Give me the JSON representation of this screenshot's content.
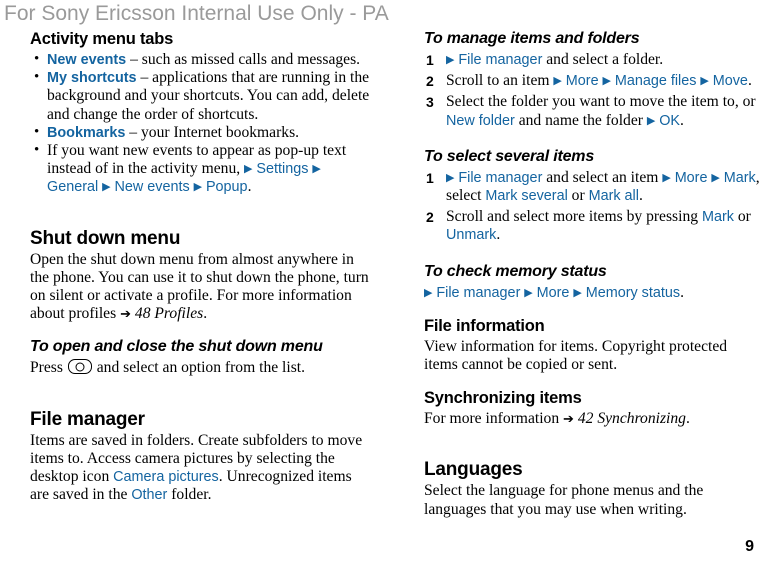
{
  "header": {
    "watermark": "For Sony Ericsson Internal Use Only - PA"
  },
  "page_number": "9",
  "left_column": {
    "activity_tabs": {
      "heading": "Activity menu tabs",
      "bullets": [
        {
          "term": "New events",
          "rest": " – such as missed calls and messages."
        },
        {
          "term": "My shortcuts",
          "rest": " – applications that are running in the background and your shortcuts. You can add, delete and change the order of shortcuts."
        },
        {
          "term": "Bookmarks",
          "rest": " – your Internet bookmarks."
        },
        {
          "plain_pre": "If you want new events to appear as pop-up text instead of in the activity menu, ",
          "path": [
            "Settings",
            "General",
            "New events",
            "Popup"
          ],
          "plain_post": "."
        }
      ]
    },
    "shut_down": {
      "heading": "Shut down menu",
      "body_pre": "Open the shut down menu from almost anywhere in the phone. You can use it to shut down the phone, turn on silent or activate a profile. For more information about profiles ",
      "xref": "48 Profiles",
      "body_post": "."
    },
    "open_close": {
      "heading": "To open and close the shut down menu",
      "press_pre": "Press ",
      "press_post": " and select an option from the list."
    },
    "file_manager": {
      "heading": "File manager",
      "part1": "Items are saved in folders. Create subfolders to move items to. Access camera pictures by selecting the desktop icon ",
      "camera_pictures": "Camera pictures",
      "part2": ". Unrecognized items are saved in the ",
      "other": "Other",
      "part3": " folder."
    }
  },
  "right_column": {
    "manage": {
      "heading": "To manage items and folders",
      "steps": [
        {
          "pre": "",
          "segs": [
            "File manager"
          ],
          "post": " and select a folder."
        },
        {
          "pre": "Scroll to an item ",
          "segs": [
            "More",
            "Manage files",
            "Move"
          ],
          "post": "."
        },
        {
          "text_pre": "Select the folder you want to move the item to, or ",
          "new_folder": "New folder",
          "text_mid": " and name the folder ",
          "ok": "OK",
          "text_post": "."
        }
      ]
    },
    "select_several": {
      "heading": "To select several items",
      "step1": {
        "pre": "",
        "file_manager": "File manager",
        "mid1": " and select an item ",
        "more": "More",
        "mid2": "Mark",
        "mid3": ", select ",
        "mark_several": "Mark several",
        "mid4": " or ",
        "mark_all": "Mark all",
        "post": "."
      },
      "step2": {
        "pre": "Scroll and select more items by pressing ",
        "mark": "Mark",
        "mid": " or ",
        "unmark": "Unmark",
        "post": "."
      }
    },
    "memory_status": {
      "heading": "To check memory status",
      "path": [
        "File manager",
        "More",
        "Memory status"
      ],
      "post": "."
    },
    "file_information": {
      "heading": "File information",
      "body": "View information for items. Copyright protected items cannot be copied or sent."
    },
    "synchronizing": {
      "heading": "Synchronizing items",
      "body_pre": "For more information ",
      "xref": "42 Synchronizing",
      "body_post": "."
    },
    "languages": {
      "heading": "Languages",
      "body": "Select the language for phone menus and the languages that you may use when writing."
    }
  }
}
